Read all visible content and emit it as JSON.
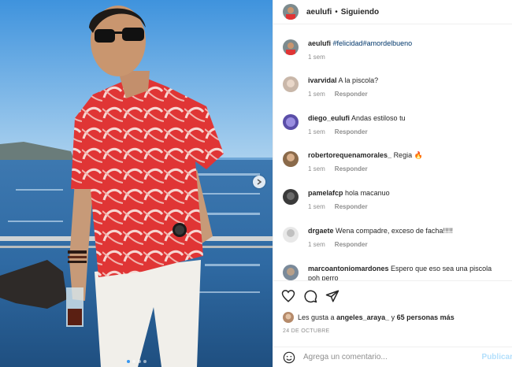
{
  "post": {
    "username": "aeulufi",
    "separator": "•",
    "follow_status": "Siguiendo",
    "photo_dots": 4,
    "active_dot": 0
  },
  "caption": {
    "username": "aeulufi",
    "hashtags": [
      "#felicidad",
      "#amordelbueno"
    ],
    "time": "1 sem"
  },
  "comments": [
    {
      "username": "ivarvidal",
      "text": "A la piscola?",
      "time": "1 sem",
      "reply_label": "Responder",
      "avatar_color": "#c9b7a9"
    },
    {
      "username": "diego_eulufi",
      "text": "Andas estiloso tu",
      "time": "1 sem",
      "reply_label": "Responder",
      "avatar_color": "#5a4ea8"
    },
    {
      "username": "robertorequenamorales_",
      "text": "Regia 🔥",
      "time": "1 sem",
      "reply_label": "Responder",
      "avatar_color": "#8a6a4a"
    },
    {
      "username": "pamelafcp",
      "text": "hola macanuo",
      "time": "1 sem",
      "reply_label": "Responder",
      "avatar_color": "#3a3a3a"
    },
    {
      "username": "drgaete",
      "text": "Wena compadre, exceso de facha!!!!!",
      "time": "1 sem",
      "reply_label": "Responder",
      "avatar_color": "#e8e8e8"
    },
    {
      "username": "marcoantoniomardones",
      "text": "Espero que eso sea una piscola poh perro",
      "time": "",
      "reply_label": "",
      "avatar_color": "#7a8a9a"
    }
  ],
  "actions": {
    "like_icon": "heart-icon",
    "comment_icon": "comment-bubble-icon",
    "share_icon": "paper-plane-icon"
  },
  "likes": {
    "prefix": "Les gusta a",
    "user": "angeles_araya_",
    "connector": "y",
    "others": "65 personas más"
  },
  "date": "24 DE OCTUBRE",
  "add_comment": {
    "placeholder": "Agrega un comentario...",
    "publish_label": "Publicar"
  },
  "colors": {
    "link": "#00376b",
    "meta": "#8e8e8e",
    "publish_disabled": "#b2dffc",
    "shirt": "#e23a3a"
  }
}
